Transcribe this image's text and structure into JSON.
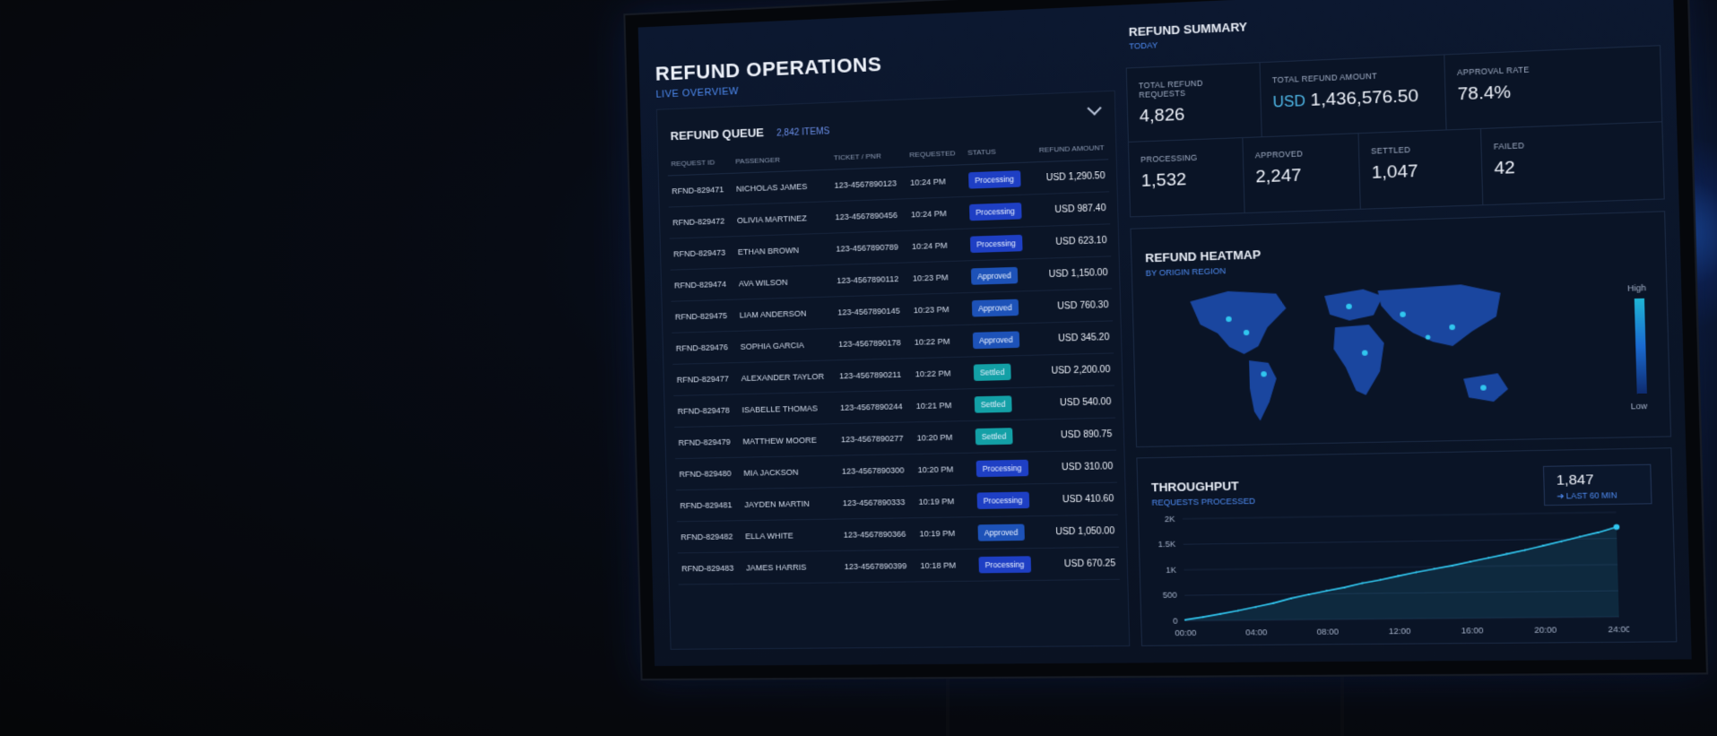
{
  "operations": {
    "title": "REFUND OPERATIONS",
    "subtitle": "LIVE OVERVIEW"
  },
  "queue": {
    "title": "REFUND QUEUE",
    "count": "2,842 ITEMS",
    "columns": [
      "REQUEST ID",
      "PASSENGER",
      "TICKET / PNR",
      "REQUESTED",
      "STATUS",
      "REFUND AMOUNT"
    ],
    "rows": [
      {
        "id": "RFND-829471",
        "passenger": "NICHOLAS JAMES",
        "ticket": "123-4567890123",
        "requested": "10:24 PM",
        "status": "Processing",
        "amount": "USD 1,290.50"
      },
      {
        "id": "RFND-829472",
        "passenger": "OLIVIA MARTINEZ",
        "ticket": "123-4567890456",
        "requested": "10:24 PM",
        "status": "Processing",
        "amount": "USD 987.40"
      },
      {
        "id": "RFND-829473",
        "passenger": "ETHAN BROWN",
        "ticket": "123-4567890789",
        "requested": "10:24 PM",
        "status": "Processing",
        "amount": "USD 623.10"
      },
      {
        "id": "RFND-829474",
        "passenger": "AVA WILSON",
        "ticket": "123-4567890112",
        "requested": "10:23 PM",
        "status": "Approved",
        "amount": "USD 1,150.00"
      },
      {
        "id": "RFND-829475",
        "passenger": "LIAM ANDERSON",
        "ticket": "123-4567890145",
        "requested": "10:23 PM",
        "status": "Approved",
        "amount": "USD 760.30"
      },
      {
        "id": "RFND-829476",
        "passenger": "SOPHIA GARCIA",
        "ticket": "123-4567890178",
        "requested": "10:22 PM",
        "status": "Approved",
        "amount": "USD 345.20"
      },
      {
        "id": "RFND-829477",
        "passenger": "ALEXANDER TAYLOR",
        "ticket": "123-4567890211",
        "requested": "10:22 PM",
        "status": "Settled",
        "amount": "USD 2,200.00"
      },
      {
        "id": "RFND-829478",
        "passenger": "ISABELLE THOMAS",
        "ticket": "123-4567890244",
        "requested": "10:21 PM",
        "status": "Settled",
        "amount": "USD 540.00"
      },
      {
        "id": "RFND-829479",
        "passenger": "MATTHEW MOORE",
        "ticket": "123-4567890277",
        "requested": "10:20 PM",
        "status": "Settled",
        "amount": "USD 890.75"
      },
      {
        "id": "RFND-829480",
        "passenger": "MIA JACKSON",
        "ticket": "123-4567890300",
        "requested": "10:20 PM",
        "status": "Processing",
        "amount": "USD 310.00"
      },
      {
        "id": "RFND-829481",
        "passenger": "JAYDEN MARTIN",
        "ticket": "123-4567890333",
        "requested": "10:19 PM",
        "status": "Processing",
        "amount": "USD 410.60"
      },
      {
        "id": "RFND-829482",
        "passenger": "ELLA WHITE",
        "ticket": "123-4567890366",
        "requested": "10:19 PM",
        "status": "Approved",
        "amount": "USD 1,050.00"
      },
      {
        "id": "RFND-829483",
        "passenger": "JAMES HARRIS",
        "ticket": "123-4567890399",
        "requested": "10:18 PM",
        "status": "Processing",
        "amount": "USD 670.25"
      }
    ]
  },
  "summary": {
    "title": "REFUND SUMMARY",
    "subtitle": "TODAY",
    "total_requests_label": "TOTAL REFUND REQUESTS",
    "total_requests": "4,826",
    "total_amount_label": "TOTAL REFUND AMOUNT",
    "total_amount_currency": "USD",
    "total_amount": "1,436,576.50",
    "approval_rate_label": "APPROVAL RATE",
    "approval_rate": "78.4%",
    "processing_label": "PROCESSING",
    "processing": "1,532",
    "approved_label": "APPROVED",
    "approved": "2,247",
    "settled_label": "SETTLED",
    "settled": "1,047",
    "failed_label": "FAILED",
    "failed": "42"
  },
  "heatmap": {
    "title": "REFUND HEATMAP",
    "subtitle": "BY ORIGIN REGION",
    "legend_high": "High",
    "legend_low": "Low"
  },
  "throughput": {
    "title": "THROUGHPUT",
    "subtitle": "REQUESTS PROCESSED",
    "value": "1,847",
    "value_label": "➜ LAST 60 MIN"
  },
  "chart_data": {
    "type": "line",
    "x_ticks": [
      "00:00",
      "04:00",
      "08:00",
      "12:00",
      "16:00",
      "20:00",
      "24:00"
    ],
    "y_ticks": [
      "0",
      "500",
      "1K",
      "1.5K",
      "2K"
    ],
    "ylim": [
      0,
      2000
    ],
    "x": [
      0,
      1,
      2,
      3,
      4,
      5,
      6,
      7,
      8,
      9,
      10,
      11,
      12,
      13,
      14,
      15,
      16,
      17,
      18,
      19,
      20,
      21,
      22,
      23,
      24
    ],
    "values": [
      20,
      70,
      130,
      190,
      260,
      330,
      420,
      490,
      560,
      620,
      700,
      760,
      830,
      900,
      960,
      1020,
      1090,
      1160,
      1230,
      1300,
      1380,
      1460,
      1540,
      1620,
      1720
    ],
    "line_color": "#31c6ef"
  }
}
